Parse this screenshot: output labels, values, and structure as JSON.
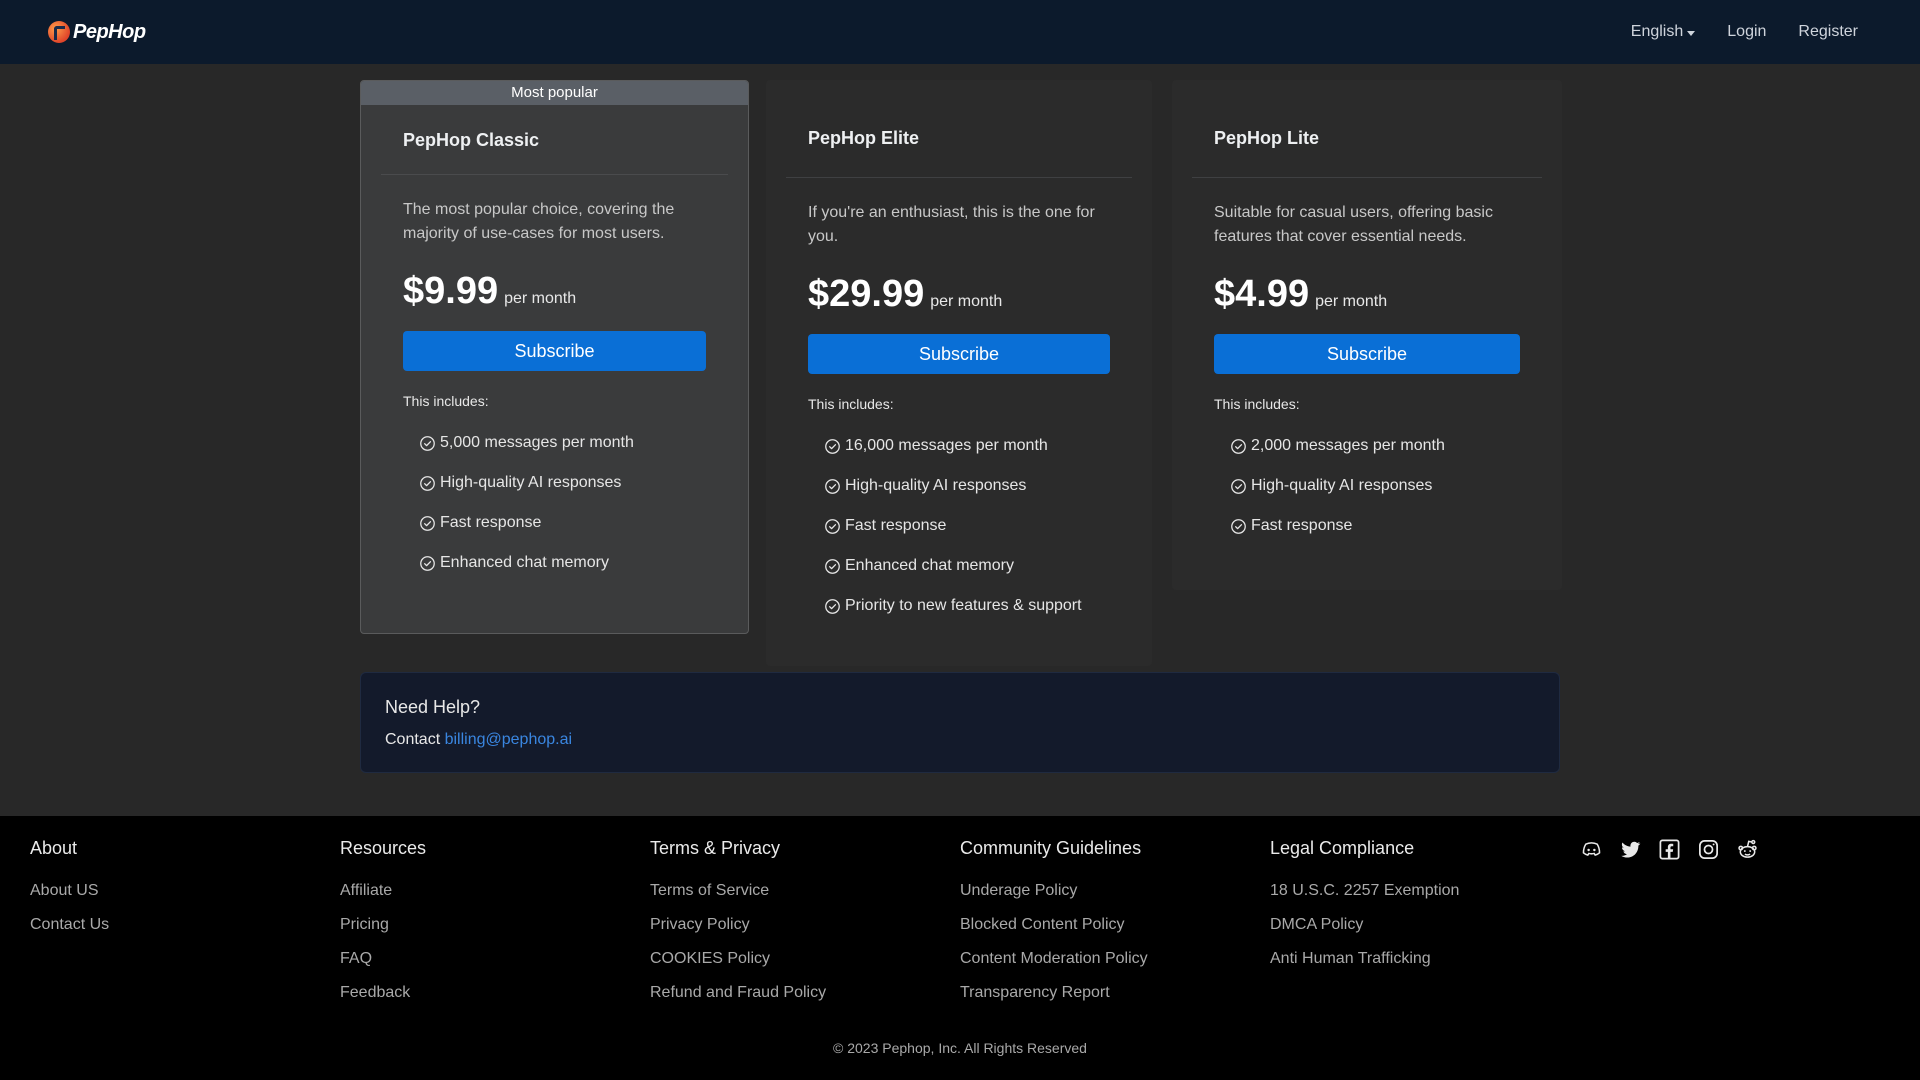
{
  "header": {
    "logo_text": "PepHop",
    "language": "English",
    "login": "Login",
    "register": "Register"
  },
  "plans": [
    {
      "badge": "Most popular",
      "name": "PepHop Classic",
      "description": "The most popular choice, covering the majority of use-cases for most users.",
      "price": "$9.99",
      "period": "per month",
      "button": "Subscribe",
      "includes_label": "This includes:",
      "features": [
        "5,000 messages per month",
        "High-quality AI responses",
        "Fast response",
        "Enhanced chat memory"
      ]
    },
    {
      "name": "PepHop Elite",
      "description": "If you're an enthusiast, this is the one for you.",
      "price": "$29.99",
      "period": "per month",
      "button": "Subscribe",
      "includes_label": "This includes:",
      "features": [
        "16,000 messages per month",
        "High-quality AI responses",
        "Fast response",
        "Enhanced chat memory",
        "Priority to new features & support"
      ]
    },
    {
      "name": "PepHop Lite",
      "description": "Suitable for casual users, offering basic features that cover essential needs.",
      "price": "$4.99",
      "period": "per month",
      "button": "Subscribe",
      "includes_label": "This includes:",
      "features": [
        "2,000 messages per month",
        "High-quality AI responses",
        "Fast response"
      ]
    }
  ],
  "help": {
    "title": "Need Help?",
    "contact_prefix": "Contact ",
    "email": "billing@pephop.ai"
  },
  "footer": {
    "columns": [
      {
        "title": "About",
        "links": [
          "About US",
          "Contact Us"
        ]
      },
      {
        "title": "Resources",
        "links": [
          "Affiliate",
          "Pricing",
          "FAQ",
          "Feedback"
        ]
      },
      {
        "title": "Terms & Privacy",
        "links": [
          "Terms of Service",
          "Privacy Policy",
          "COOKIES Policy",
          "Refund and Fraud Policy"
        ]
      },
      {
        "title": "Community Guidelines",
        "links": [
          "Underage Policy",
          "Blocked Content Policy",
          "Content Moderation Policy",
          "Transparency Report"
        ]
      },
      {
        "title": "Legal Compliance",
        "links": [
          "18 U.S.C. 2257 Exemption",
          "DMCA Policy",
          "Anti Human Trafficking"
        ]
      }
    ],
    "socials": [
      "discord-icon",
      "twitter-icon",
      "facebook-icon",
      "instagram-icon",
      "reddit-icon"
    ],
    "copyright": "© 2023 Pephop, Inc. All Rights Reserved"
  },
  "colors": {
    "header_bg": "#0c1a2c",
    "page_bg": "#282828",
    "accent": "#0a6fd6",
    "link": "#3a86e0",
    "footer_bg": "#000000"
  }
}
